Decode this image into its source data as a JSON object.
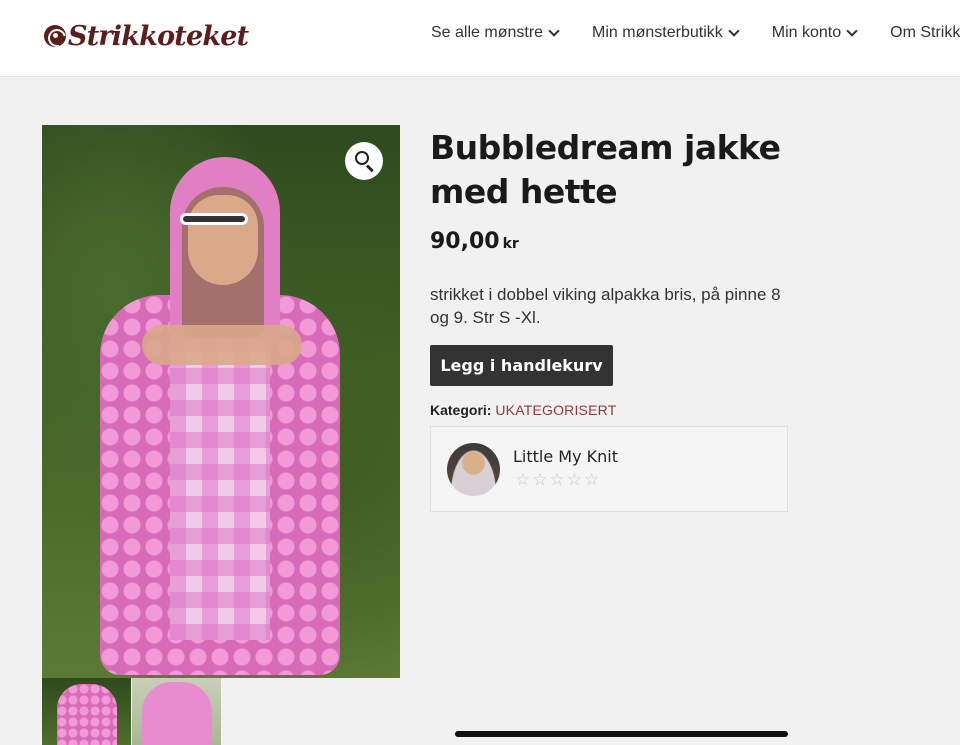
{
  "header": {
    "logo_text": "Strikkoteket",
    "nav": [
      {
        "label": "Se alle mønstre",
        "has_dropdown": true
      },
      {
        "label": "Min mønsterbutikk",
        "has_dropdown": true
      },
      {
        "label": "Min konto",
        "has_dropdown": true
      },
      {
        "label": "Om Strikkoteket",
        "has_dropdown": false
      }
    ]
  },
  "product": {
    "title": "Bubbledream jakke med hette",
    "price": "90,00",
    "currency": "kr",
    "description": "strikket i dobbel viking alpakka bris, på pinne 8 og 9. Str S -Xl.",
    "add_to_cart_label": "Legg i handlekurv",
    "category_label": "Kategori:",
    "category_value": "UKATEGORISERT",
    "zoom_icon": "magnifier-icon",
    "thumbnails": 2
  },
  "vendor": {
    "name": "Little My Knit",
    "rating_stars": 0,
    "max_stars": 5
  },
  "colors": {
    "brand": "#5c1d1d",
    "button": "#333333",
    "link": "#8e3a3a"
  }
}
